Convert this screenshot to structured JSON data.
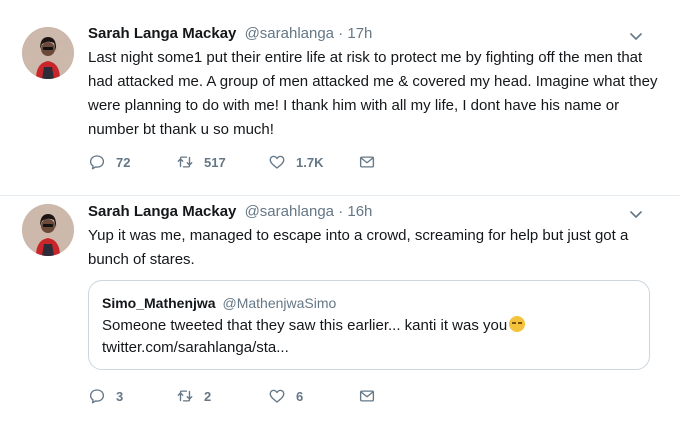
{
  "tweets": [
    {
      "author": {
        "name": "Sarah Langa Mackay",
        "handle": "@sarahlanga"
      },
      "separator": "·",
      "time": "17h",
      "text": "Last night some1 put their entire life at risk to protect me by fighting off the men that had attacked me. A group of men attacked me & covered my head. Imagine what they were planning to do with me! I thank him with all my life, I dont have his name or number bt thank u so much!",
      "actions": {
        "replies": "72",
        "retweets": "517",
        "likes": "1.7K"
      }
    },
    {
      "author": {
        "name": "Sarah Langa Mackay",
        "handle": "@sarahlanga"
      },
      "separator": "·",
      "time": "16h",
      "text": "Yup it was me, managed to escape into a crowd, screaming for help but just got a bunch of stares.",
      "quote": {
        "name": "Simo_Mathenjwa",
        "handle": "@MathenjwaSimo",
        "text": "Someone tweeted that they saw this earlier... kanti it was you",
        "link": "twitter.com/sarahlanga/sta..."
      },
      "actions": {
        "replies": "3",
        "retweets": "2",
        "likes": "6"
      }
    }
  ],
  "icons": {
    "reply": "reply-icon",
    "retweet": "retweet-icon",
    "like": "heart-icon",
    "message": "envelope-icon",
    "menu": "chevron-down-icon",
    "emoji": "relieved-face-emoji"
  },
  "colors": {
    "text": "#14171a",
    "muted": "#657786",
    "border": "#e6ecf0",
    "quote_border": "#ccd6dd"
  }
}
